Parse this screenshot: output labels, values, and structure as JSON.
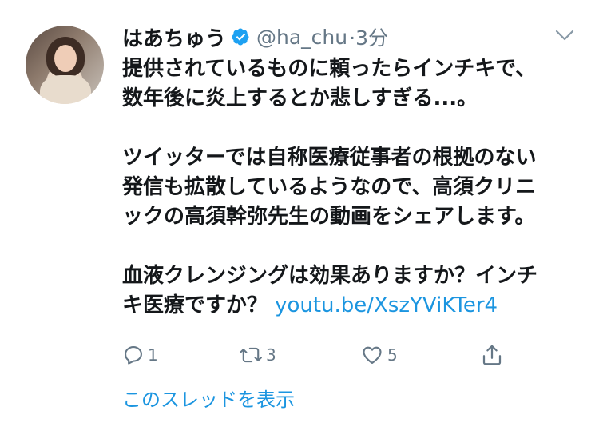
{
  "tweet": {
    "author_name": "はあちゅう",
    "handle": "@ha_chu",
    "time": "·3分",
    "text_lines": [
      "提供されているものに頼ったらインチキで、",
      "数年後に炎上するとか悲しすぎる...。",
      "",
      "ツイッターでは自称医療従事者の根拠のない",
      "発信も拡散しているようなので、高須クリニ",
      "ックの高須幹弥先生の動画をシェアします。",
      "",
      "血液クレンジングは効果ありますか？インチ"
    ],
    "last_line_text": "キ医療ですか？ ",
    "link": "youtu.be/XszYViKTer4"
  },
  "actions": {
    "reply_count": "1",
    "retweet_count": "3",
    "like_count": "5"
  },
  "thread_link": "このスレッドを表示",
  "icons": [
    "verified-icon",
    "chevron-down-icon",
    "reply-icon",
    "retweet-icon",
    "like-icon",
    "share-icon"
  ],
  "colors": {
    "accent": "#1b95e0",
    "muted": "#657786",
    "text": "#14171a"
  }
}
